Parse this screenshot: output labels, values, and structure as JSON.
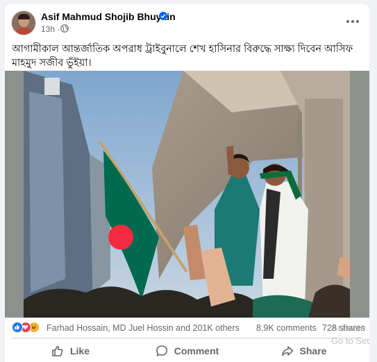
{
  "post": {
    "author": "Asif Mahmud Shojib Bhuyain",
    "time": "13h",
    "caption": "আগামীকাল আন্তর্জাতিক অপরাধ ট্রাইবুনালে শেখ হাসিনার বিরুদ্ধে সাক্ষ্য দিবেন আসিফ মাহমুদ সজীব ভুঁইয়া।",
    "audience_icon": "globe-icon",
    "photo_description": "Protest photo with Bangladesh flag under flyover"
  },
  "reactions": {
    "icons": [
      "like-icon",
      "love-icon",
      "haha-icon"
    ],
    "summary": "Farhad Hossain, MD Juel Hossin and 201K others",
    "comments": "8.9K comments",
    "shares": "728 shares"
  },
  "actions": {
    "like_label": "Like",
    "comment_label": "Comment",
    "share_label": "Share"
  },
  "overlay": {
    "activate_line1": "Activate",
    "activate_line2": "Go to Setti"
  },
  "colors": {
    "verified": "#0866ff",
    "like": "#1877f2",
    "love": "#f33e58",
    "haha": "#f7b125",
    "flag_green": "#006a4e",
    "flag_red": "#f42a41"
  }
}
